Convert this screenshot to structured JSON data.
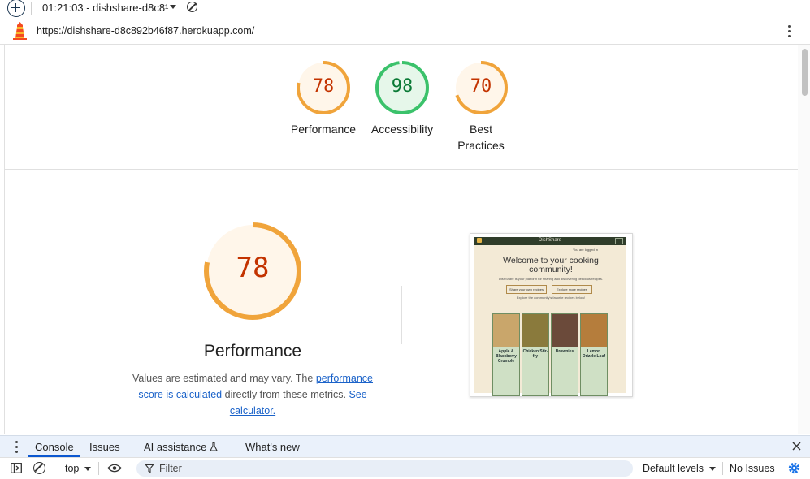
{
  "toolbar": {
    "timestamp_label": "01:21:03 - dishshare-d8c8¹"
  },
  "address": {
    "url": "https://dishshare-d8c892b46f87.herokuapp.com/"
  },
  "summary_gauges": [
    {
      "score": "78",
      "label": "Performance",
      "color": "#f0a43b"
    },
    {
      "score": "98",
      "label": "Accessibility",
      "color": "#3bc26b"
    },
    {
      "score": "70",
      "label": "Best",
      "label2": "Practices",
      "color": "#f0a43b"
    }
  ],
  "performance": {
    "score": "78",
    "title": "Performance",
    "desc_prefix": "Values are estimated and may vary. The ",
    "desc_link1": "performance score is calculated",
    "desc_middle": " directly from these metrics. ",
    "desc_link2": "See calculator."
  },
  "screenshot": {
    "app_name": "DishShare",
    "logged_in": "You are logged in",
    "heading": "Welcome to your cooking community!",
    "tagline": "DishShare is your platform for sharing and discovering delicious recipes.",
    "btn_share": "Share your own recipes",
    "btn_explore": "Explore more recipes",
    "favorites": "Explore the community's favorite recipes below!",
    "cards": [
      {
        "title": "Apple & Blackberry Crumble",
        "color": "#c9a66b"
      },
      {
        "title": "Chicken Stir-fry",
        "color": "#8a7a3c"
      },
      {
        "title": "Brownies",
        "color": "#6b4a3a"
      },
      {
        "title": "Lemon Drizzle Loaf",
        "color": "#b57d3c"
      }
    ]
  },
  "devtools": {
    "tabs": [
      "Console",
      "Issues",
      "AI assistance",
      "What's new"
    ],
    "context": "top",
    "filter_placeholder": "Filter",
    "levels": "Default levels",
    "issues": "No Issues"
  }
}
